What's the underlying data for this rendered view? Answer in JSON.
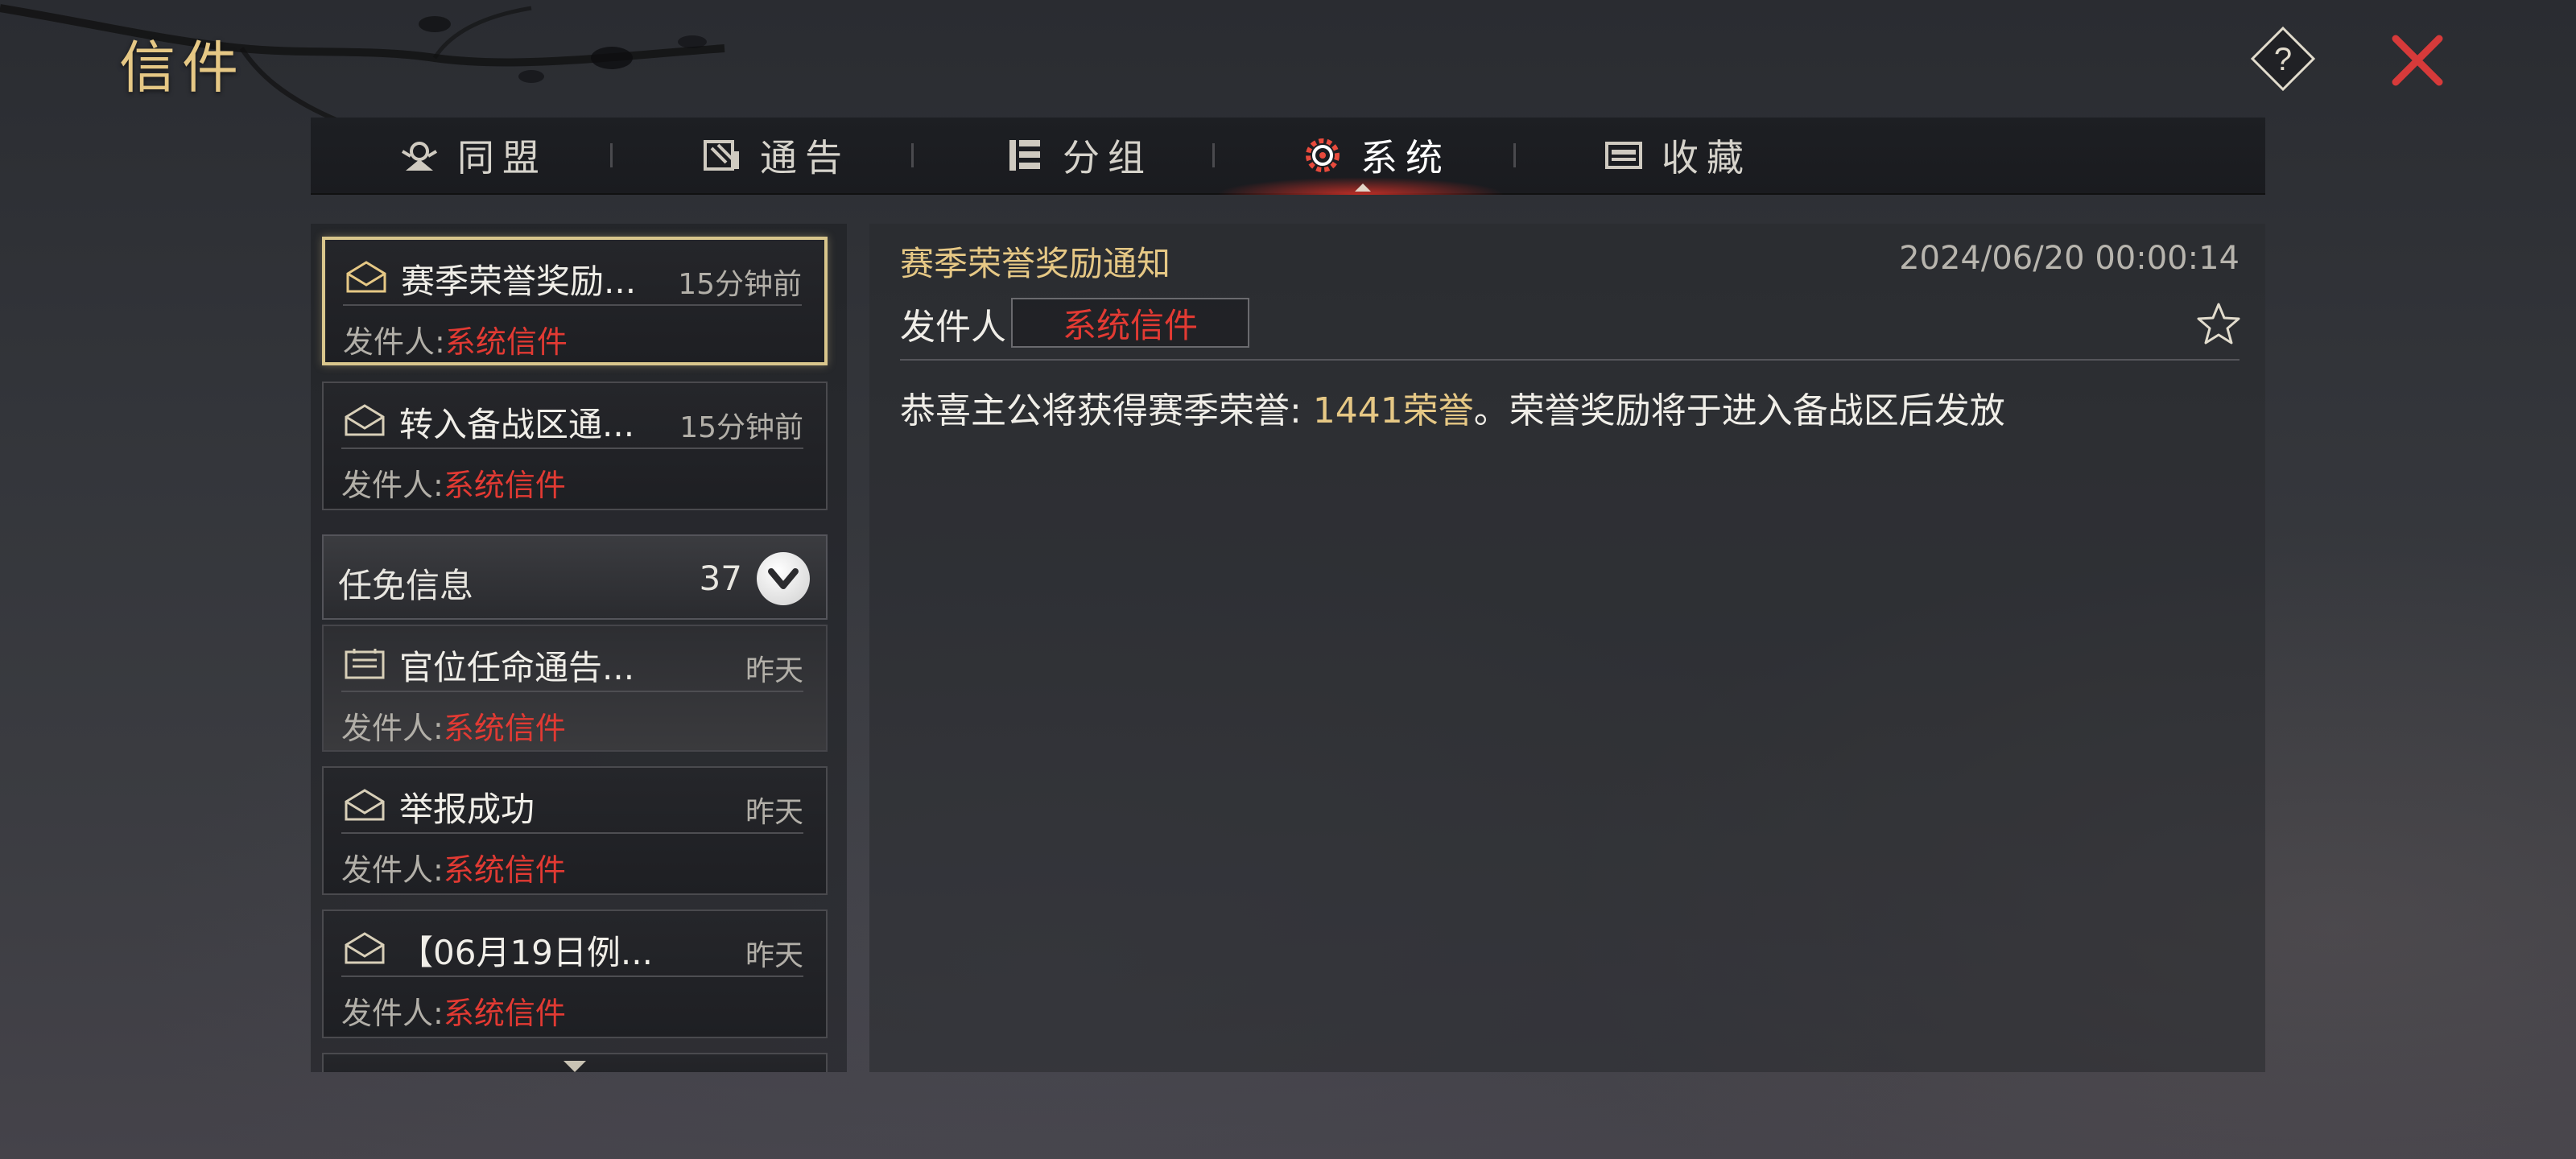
{
  "header": {
    "title": "信件"
  },
  "tabs": [
    {
      "label": "同盟",
      "icon": "alliance-icon",
      "active": false
    },
    {
      "label": "通告",
      "icon": "announcement-icon",
      "active": false
    },
    {
      "label": "分组",
      "icon": "group-icon",
      "active": false
    },
    {
      "label": "系统",
      "icon": "system-gear-icon",
      "active": true
    },
    {
      "label": "收藏",
      "icon": "favorites-icon",
      "active": false
    }
  ],
  "mail_list": {
    "sender_prefix": "发件人:",
    "items": [
      {
        "subject": "赛季荣誉奖励...",
        "time": "15分钟前",
        "sender": "系统信件",
        "icon": "envelope-icon",
        "selected": true
      },
      {
        "subject": "转入备战区通...",
        "time": "15分钟前",
        "sender": "系统信件",
        "icon": "envelope-icon",
        "selected": false
      }
    ],
    "group": {
      "label": "任免信息",
      "count": "37",
      "items": [
        {
          "subject": "官位任命通告...",
          "time": "昨天",
          "sender": "系统信件",
          "icon": "notice-scroll-icon"
        }
      ]
    },
    "items_after": [
      {
        "subject": "举报成功",
        "time": "昨天",
        "sender": "系统信件",
        "icon": "envelope-icon"
      },
      {
        "subject": "【06月19日例...",
        "time": "昨天",
        "sender": "系统信件",
        "icon": "envelope-icon"
      }
    ]
  },
  "detail": {
    "title": "赛季荣誉奖励通知",
    "datetime": "2024/06/20 00:00:14",
    "sender_label": "发件人",
    "sender": "系统信件",
    "body_prefix": "恭喜主公将获得赛季荣誉: ",
    "body_highlight": "1441荣誉",
    "body_suffix": "。荣誉奖励将于进入备战区后发放"
  },
  "colors": {
    "gold": "#e6c885",
    "red": "#e23a33",
    "close_red": "#d63a3a"
  }
}
